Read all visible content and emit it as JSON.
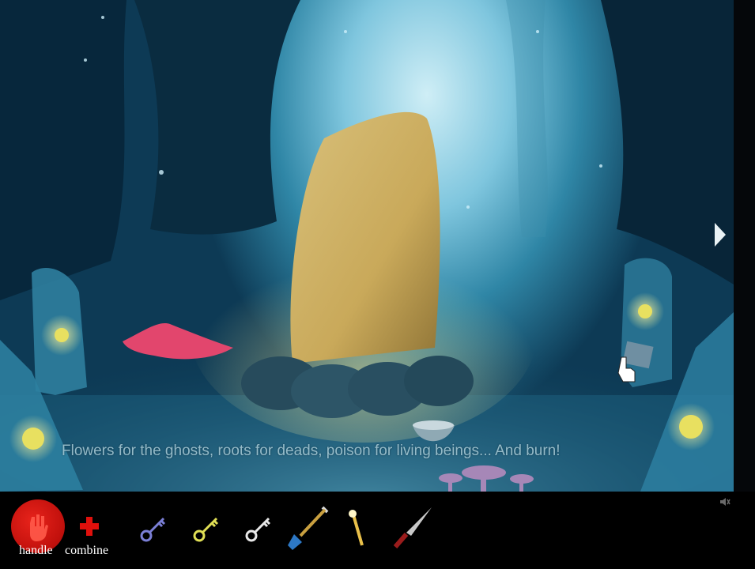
{
  "scene": {
    "name": "stone-circle-forest",
    "caption": "Flowers for the ghosts, roots for deads, poison for living beings... And burn!"
  },
  "toolbar": {
    "handle_label": "handle",
    "combine_label": "combine",
    "inventory": [
      {
        "name": "blue-key",
        "color": "#7b7fd6"
      },
      {
        "name": "gold-key",
        "color": "#e0df55"
      },
      {
        "name": "white-key",
        "color": "#e8e8e8"
      },
      {
        "name": "shovel",
        "color": "#2d78c5"
      },
      {
        "name": "torch",
        "color": "#e9c04a"
      },
      {
        "name": "knife",
        "color": "#c8c8c8"
      }
    ]
  },
  "colors": {
    "accent_red": "#e8231b",
    "caption_text": "#a9cbd6",
    "glow": "#e8e060"
  }
}
